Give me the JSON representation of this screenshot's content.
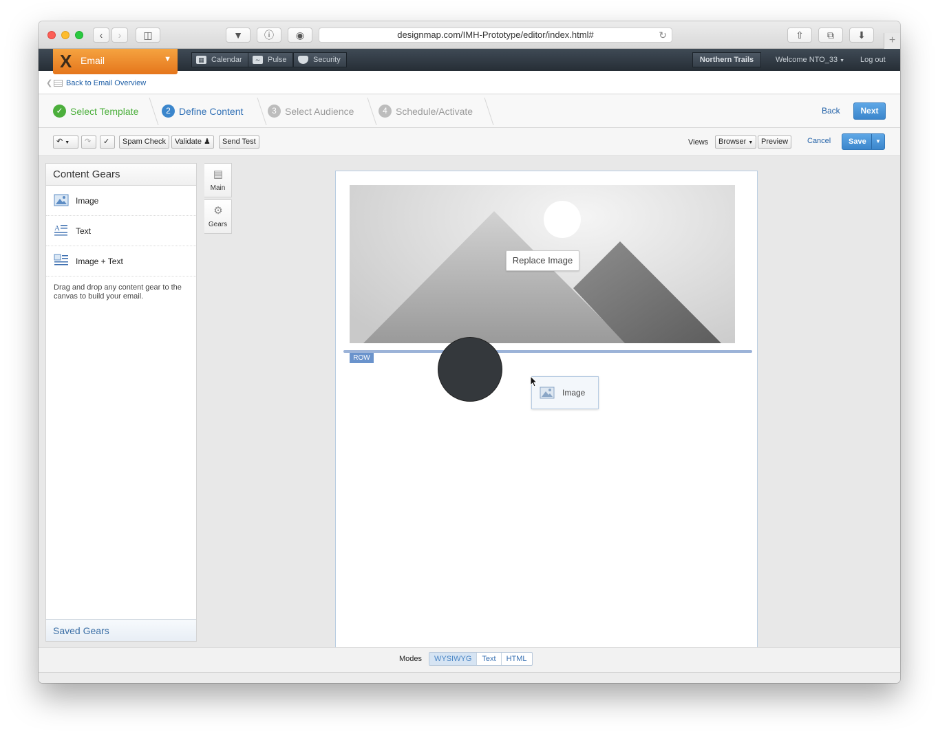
{
  "browser": {
    "url": "designmap.com/IMH-Prototype/editor/index.html#",
    "new_tab_symbol": "+"
  },
  "app_nav": {
    "product": "Email",
    "nav_items": [
      {
        "label": "Calendar",
        "icon": "calendar-icon"
      },
      {
        "label": "Pulse",
        "icon": "pulse-icon"
      },
      {
        "label": "Security",
        "icon": "shield-icon"
      }
    ],
    "org": "Northern Trails",
    "welcome": "Welcome NTO_33",
    "logout": "Log out"
  },
  "back_link": "Back to Email Overview",
  "wizard": {
    "steps": [
      {
        "label": "Select Template",
        "status": "complete",
        "number": "✓"
      },
      {
        "label": "Define Content",
        "status": "active",
        "number": "2"
      },
      {
        "label": "Select Audience",
        "status": "pending",
        "number": "3"
      },
      {
        "label": "Schedule/Activate",
        "status": "pending",
        "number": "4"
      }
    ],
    "back_label": "Back",
    "next_label": "Next"
  },
  "toolbar": {
    "spam_check": "Spam Check",
    "validate": "Validate",
    "send_test": "Send Test",
    "views_label": "Views",
    "views_value": "Browser",
    "preview": "Preview",
    "cancel": "Cancel",
    "save": "Save"
  },
  "side_panel": {
    "title": "Content Gears",
    "gears": [
      {
        "label": "Image",
        "icon": "image-icon"
      },
      {
        "label": "Text",
        "icon": "text-icon"
      },
      {
        "label": "Image + Text",
        "icon": "image-text-icon"
      }
    ],
    "help_text": "Drag and drop any content gear to the canvas to build your email.",
    "saved_gears": "Saved Gears"
  },
  "vertical_tabs": [
    {
      "label": "Main",
      "icon": "list-icon"
    },
    {
      "label": "Gears",
      "icon": "gear-icon"
    }
  ],
  "canvas": {
    "replace_image": "Replace Image",
    "row_tag": "ROW",
    "drag_item": "Image"
  },
  "modes": {
    "label": "Modes",
    "options": [
      "WYSIWYG",
      "Text",
      "HTML"
    ],
    "active": "WYSIWYG"
  },
  "colors": {
    "accent": "#3b86cc",
    "email_tab": "#e5761c",
    "step_complete": "#4caf3c",
    "link": "#1f5fa6"
  }
}
